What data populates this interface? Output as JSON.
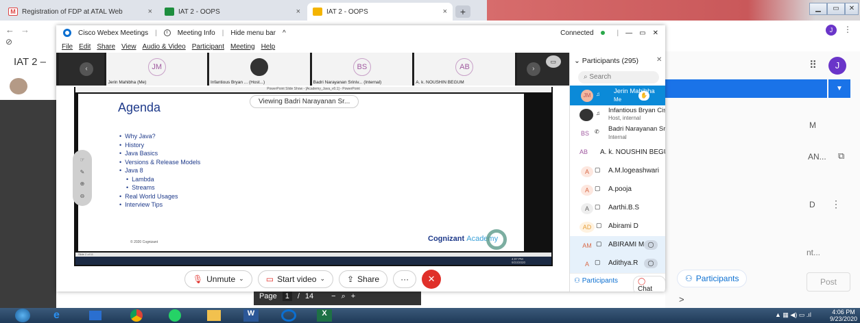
{
  "browser": {
    "tabs": [
      {
        "label": "Registration of FDP at ATAL Web",
        "close": "×"
      },
      {
        "label": "IAT 2 - OOPS",
        "close": "×"
      },
      {
        "label": "IAT 2 - OOPS",
        "close": "×"
      }
    ],
    "new_tab": "+",
    "page_title_left": "IAT 2 –",
    "right_letter": "J",
    "right_text": "AN...",
    "right_text2": "nt...",
    "post_label": "Post",
    "right_o": "D",
    "right_m": "M",
    "chevron": ">"
  },
  "webex": {
    "app_name": "Cisco Webex Meetings",
    "meeting_info": "Meeting Info",
    "hide_menu": "Hide menu bar",
    "status": "Connected",
    "menu": [
      "File",
      "Edit",
      "Share",
      "View",
      "Audio & Video",
      "Participant",
      "Meeting",
      "Help"
    ],
    "thumbs": [
      {
        "initials": "JM",
        "name": "Jerin Mahibha (Me)"
      },
      {
        "initials": "",
        "name": "Infantious Bryan ... (Host...)"
      },
      {
        "initials": "BS",
        "name": "Badri Narayanan Sriniv... (Internal)"
      },
      {
        "initials": "AB",
        "name": "A. k. NOUSHIN BEGUM"
      }
    ],
    "viewing": "Viewing Badri Narayanan Sr...",
    "slide": {
      "ppt_title": "PowerPoint Slide Show - [Academy_Java_v0.1] - PowerPoint",
      "title": "Agenda",
      "bullets": [
        "Why Java?",
        "History",
        "Java Basics",
        "Versions & Release Models",
        "Java 8"
      ],
      "sub_bullets": [
        "Lambda",
        "Streams"
      ],
      "bullets2": [
        "Real World Usages",
        "Interview Tips"
      ],
      "copyright": "© 2020 Cognizant",
      "brand": "Cognizant",
      "brand2": "Academy",
      "slide_num": "Slide 2 of 11",
      "time": "4:07 PM",
      "date": "9/23/2020"
    },
    "controls": {
      "unmute": "Unmute",
      "start_video": "Start video",
      "share": "Share",
      "more": "···",
      "participants": "Participants",
      "chat": "Chat"
    },
    "page_nav": {
      "label": "Page",
      "current": "1",
      "sep": "/",
      "total": "14"
    },
    "participants": {
      "header": "Participants (295)",
      "search_placeholder": "Search",
      "list": [
        {
          "initials": "JM",
          "name": "Jerin Mahibha",
          "sub": "Me"
        },
        {
          "initials": "",
          "name": "Infantious Bryan Cisarrio I",
          "sub": "Host, internal"
        },
        {
          "initials": "BS",
          "name": "Badri Narayanan Srinivasan",
          "sub": "Internal"
        },
        {
          "initials": "AB",
          "name": "A. k. NOUSHIN BEGUM",
          "sub": ""
        },
        {
          "initials": "A",
          "name": "A.M.logeashwari",
          "sub": ""
        },
        {
          "initials": "A",
          "name": "A.pooja",
          "sub": ""
        },
        {
          "initials": "A",
          "name": "Aarthi.B.S",
          "sub": ""
        },
        {
          "initials": "AD",
          "name": "Abirami D",
          "sub": ""
        },
        {
          "initials": "AM",
          "name": "ABIRAMI M",
          "sub": ""
        },
        {
          "initials": "A",
          "name": "Adithya.R",
          "sub": ""
        }
      ]
    }
  },
  "taskbar": {
    "time": "4:06 PM",
    "date": "9/23/2020"
  },
  "colors": {
    "accent": "#1a73e8",
    "webex_blue": "#0b6fd1",
    "mute_red": "#e0302a"
  }
}
